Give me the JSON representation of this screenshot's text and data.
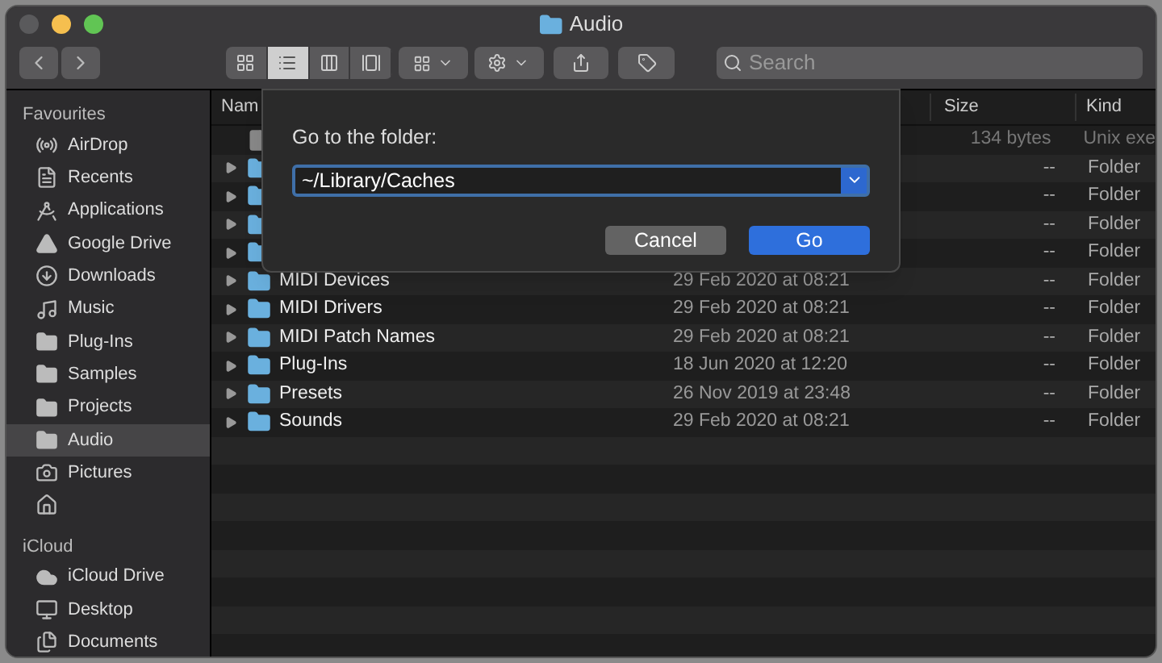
{
  "window": {
    "title": "Audio"
  },
  "toolbar": {
    "view_modes": [
      {
        "kind": "icons",
        "selected": false
      },
      {
        "kind": "list",
        "selected": true
      },
      {
        "kind": "columns",
        "selected": false
      },
      {
        "kind": "gallery",
        "selected": false
      }
    ],
    "search": {
      "placeholder": "Search"
    }
  },
  "sidebar": {
    "sections": [
      {
        "title": "Favourites",
        "items": [
          {
            "kind": "airdrop",
            "label": "AirDrop",
            "selected": false
          },
          {
            "kind": "recents",
            "label": "Recents",
            "selected": false
          },
          {
            "kind": "applications",
            "label": "Applications",
            "selected": false
          },
          {
            "kind": "gdrive",
            "label": "Google Drive",
            "selected": false
          },
          {
            "kind": "downloads",
            "label": "Downloads",
            "selected": false
          },
          {
            "kind": "music",
            "label": "Music",
            "selected": false
          },
          {
            "kind": "folder",
            "label": "Plug-Ins",
            "selected": false
          },
          {
            "kind": "folder",
            "label": "Samples",
            "selected": false
          },
          {
            "kind": "folder",
            "label": "Projects",
            "selected": false
          },
          {
            "kind": "folder",
            "label": "Audio",
            "selected": true
          },
          {
            "kind": "pictures",
            "label": "Pictures",
            "selected": false
          },
          {
            "kind": "home",
            "selected": false
          }
        ]
      },
      {
        "title": "iCloud",
        "items": [
          {
            "kind": "cloud",
            "label": "iCloud Drive",
            "selected": false
          },
          {
            "kind": "desktop",
            "label": "Desktop",
            "selected": false
          },
          {
            "kind": "documents",
            "label": "Documents",
            "selected": false
          }
        ]
      }
    ]
  },
  "table": {
    "columns": [
      "Nam",
      "Size",
      "Kind"
    ],
    "rows": [
      {
        "kind": "file",
        "size": "134 bytes",
        "type": "Unix exe"
      },
      {
        "kind": "folder",
        "size": "--",
        "type": "Folder"
      },
      {
        "kind": "folder",
        "size": "--",
        "type": "Folder"
      },
      {
        "kind": "folder",
        "size": "--",
        "type": "Folder"
      },
      {
        "kind": "folder",
        "size": "--",
        "type": "Folder"
      },
      {
        "kind": "folder",
        "name": "MIDI Devices",
        "date": "29 Feb 2020 at 08:21",
        "size": "--",
        "type": "Folder"
      },
      {
        "kind": "folder",
        "name": "MIDI Drivers",
        "date": "29 Feb 2020 at 08:21",
        "size": "--",
        "type": "Folder"
      },
      {
        "kind": "folder",
        "name": "MIDI Patch Names",
        "date": "29 Feb 2020 at 08:21",
        "size": "--",
        "type": "Folder"
      },
      {
        "kind": "folder",
        "name": "Plug-Ins",
        "date": "18 Jun 2020 at 12:20",
        "size": "--",
        "type": "Folder"
      },
      {
        "kind": "folder",
        "name": "Presets",
        "date": "26 Nov 2019 at 23:48",
        "size": "--",
        "type": "Folder"
      },
      {
        "kind": "folder",
        "name": "Sounds",
        "date": "29 Feb 2020 at 08:21",
        "size": "--",
        "type": "Folder"
      }
    ]
  },
  "dialog": {
    "label": "Go to the folder:",
    "value": "~/Library/Caches",
    "buttons": [
      {
        "label": "Cancel",
        "kind": "secondary"
      },
      {
        "label": "Go",
        "kind": "primary"
      }
    ]
  }
}
